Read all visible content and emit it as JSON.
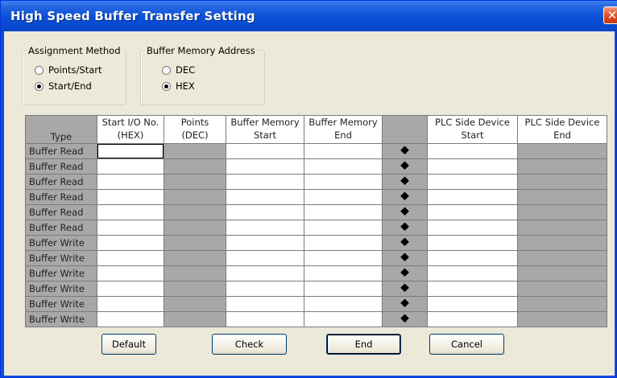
{
  "window": {
    "title": "High Speed Buffer Transfer Setting",
    "close_label": "✕"
  },
  "assignment_method": {
    "label": "Assignment Method",
    "options": [
      "Points/Start",
      "Start/End"
    ],
    "selected": "Start/End"
  },
  "buffer_memory_address": {
    "label": "Buffer Memory Address",
    "options": [
      "DEC",
      "HEX"
    ],
    "selected": "HEX"
  },
  "table": {
    "headers": [
      {
        "line1": "",
        "line2": "Type"
      },
      {
        "line1": "Start I/O No.",
        "line2": "(HEX)"
      },
      {
        "line1": "Points",
        "line2": "(DEC)"
      },
      {
        "line1": "Buffer Memory",
        "line2": "Start"
      },
      {
        "line1": "Buffer Memory",
        "line2": "End"
      },
      {
        "line1": "",
        "line2": ""
      },
      {
        "line1": "PLC Side Device",
        "line2": "Start"
      },
      {
        "line1": "PLC Side Device",
        "line2": "End"
      }
    ],
    "rows": [
      {
        "type": "Buffer Read"
      },
      {
        "type": "Buffer Read"
      },
      {
        "type": "Buffer Read"
      },
      {
        "type": "Buffer Read"
      },
      {
        "type": "Buffer Read"
      },
      {
        "type": "Buffer Read"
      },
      {
        "type": "Buffer Write"
      },
      {
        "type": "Buffer Write"
      },
      {
        "type": "Buffer Write"
      },
      {
        "type": "Buffer Write"
      },
      {
        "type": "Buffer Write"
      },
      {
        "type": "Buffer Write"
      }
    ],
    "arrow_icon": "⯁"
  },
  "buttons": {
    "default": "Default",
    "check": "Check",
    "end": "End",
    "cancel": "Cancel"
  }
}
